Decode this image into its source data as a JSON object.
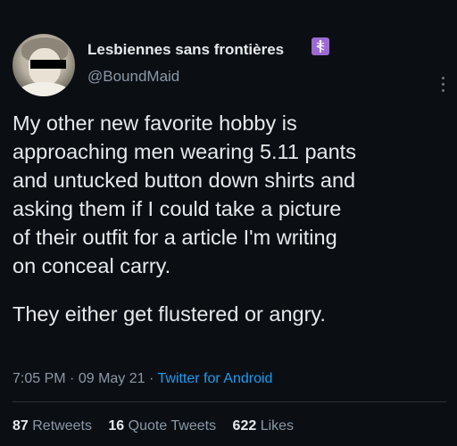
{
  "author": {
    "display_name": "Lesbiennes sans frontières",
    "handle": "@BoundMaid",
    "badge_icon": "caduceus-icon",
    "badge_color": "#9b6bd2"
  },
  "tweet": {
    "text_1": "My other new favorite hobby is\napproaching men wearing 5.11 pants\nand untucked button down shirts and\nasking them if I could take a picture\nof their outfit for a article I'm writing\non conceal carry.",
    "text_2": "They either get flustered or angry.",
    "time": "7:05 PM",
    "separator": "·",
    "date": "09 May 21",
    "source": "Twitter for Android"
  },
  "stats": {
    "retweets_count": "87",
    "retweets_label": "Retweets",
    "quotes_count": "16",
    "quotes_label": "Quote Tweets",
    "likes_count": "622",
    "likes_label": "Likes"
  },
  "colors": {
    "background": "#0b0f14",
    "text": "#e7e9ea",
    "secondary": "#8b98a5",
    "link": "#1d9bf0"
  }
}
